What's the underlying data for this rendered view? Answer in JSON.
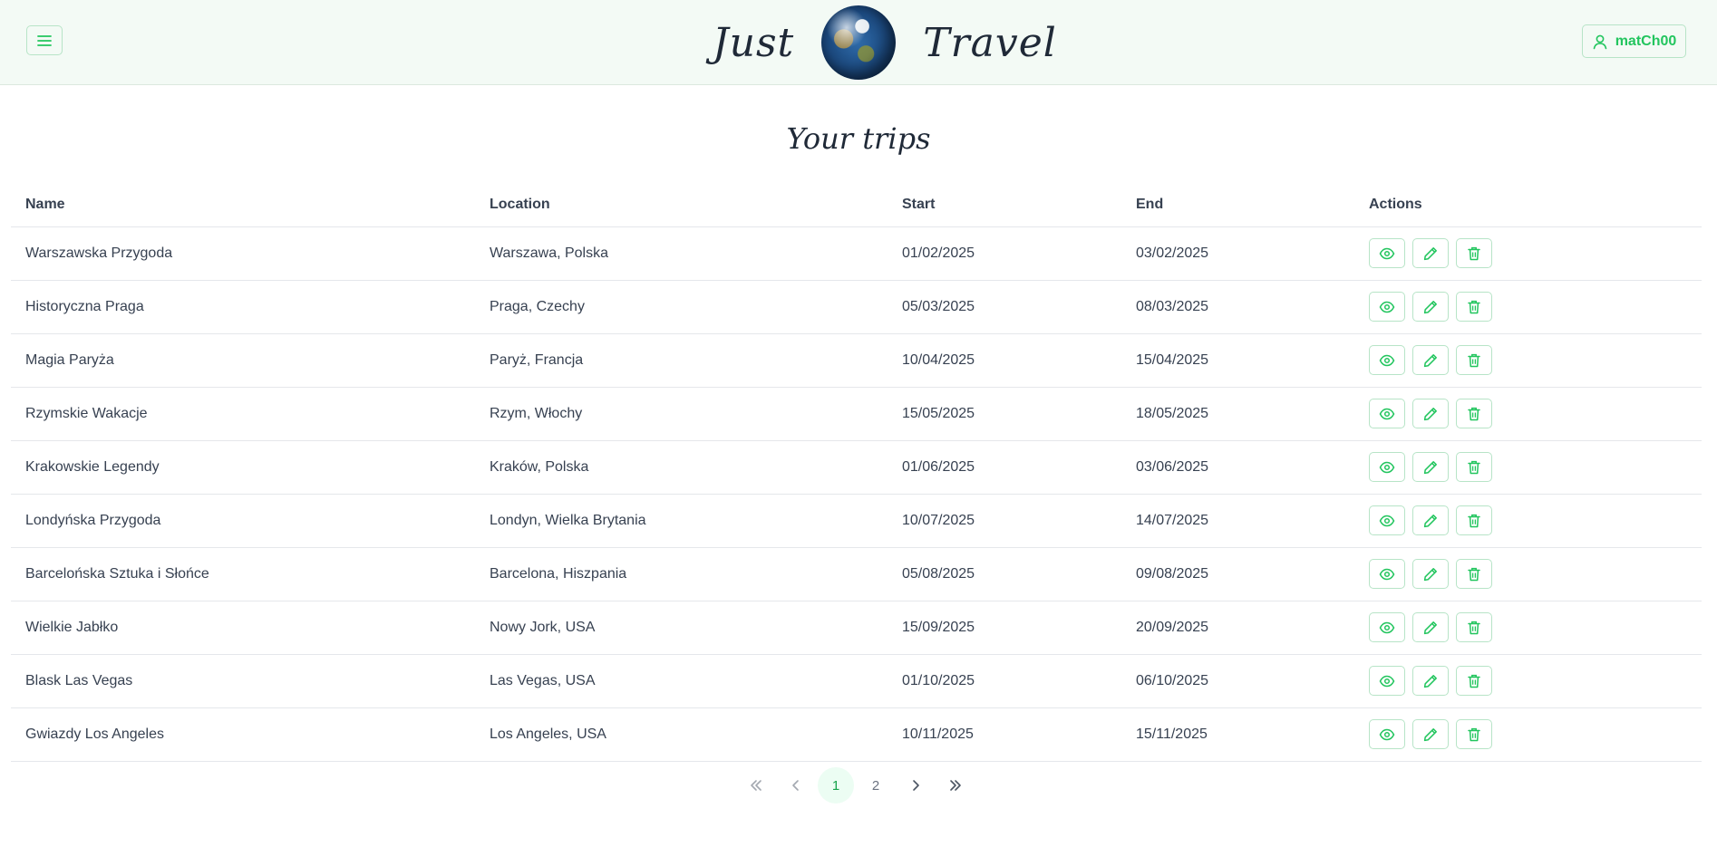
{
  "header": {
    "brand_left": "Just",
    "brand_right": "Travel",
    "username": "matCh00",
    "menu_icon": "hamburger-menu-icon",
    "user_icon": "user-icon"
  },
  "page_title": "Your trips",
  "table": {
    "columns": [
      "Name",
      "Location",
      "Start",
      "End",
      "Actions"
    ],
    "rows": [
      {
        "name": "Warszawska Przygoda",
        "location": "Warszawa, Polska",
        "start": "01/02/2025",
        "end": "03/02/2025"
      },
      {
        "name": "Historyczna Praga",
        "location": "Praga, Czechy",
        "start": "05/03/2025",
        "end": "08/03/2025"
      },
      {
        "name": "Magia Paryża",
        "location": "Paryż, Francja",
        "start": "10/04/2025",
        "end": "15/04/2025"
      },
      {
        "name": "Rzymskie Wakacje",
        "location": "Rzym, Włochy",
        "start": "15/05/2025",
        "end": "18/05/2025"
      },
      {
        "name": "Krakowskie Legendy",
        "location": "Kraków, Polska",
        "start": "01/06/2025",
        "end": "03/06/2025"
      },
      {
        "name": "Londyńska Przygoda",
        "location": "Londyn, Wielka Brytania",
        "start": "10/07/2025",
        "end": "14/07/2025"
      },
      {
        "name": "Barcelońska Sztuka i Słońce",
        "location": "Barcelona, Hiszpania",
        "start": "05/08/2025",
        "end": "09/08/2025"
      },
      {
        "name": "Wielkie Jabłko",
        "location": "Nowy Jork, USA",
        "start": "15/09/2025",
        "end": "20/09/2025"
      },
      {
        "name": "Blask Las Vegas",
        "location": "Las Vegas, USA",
        "start": "01/10/2025",
        "end": "06/10/2025"
      },
      {
        "name": "Gwiazdy Los Angeles",
        "location": "Los Angeles, USA",
        "start": "10/11/2025",
        "end": "15/11/2025"
      }
    ],
    "row_action_icons": [
      "eye-icon",
      "pencil-icon",
      "trash-icon"
    ]
  },
  "pagination": {
    "pages": [
      "1",
      "2"
    ],
    "current_page": "1",
    "first_icon": "chevrons-left-icon",
    "prev_icon": "chevron-left-icon",
    "next_icon": "chevron-right-icon",
    "last_icon": "chevrons-right-icon"
  },
  "colors": {
    "accent": "#22c55e",
    "header_bg": "#f3faf5",
    "border_accent": "#b7e4c7"
  }
}
